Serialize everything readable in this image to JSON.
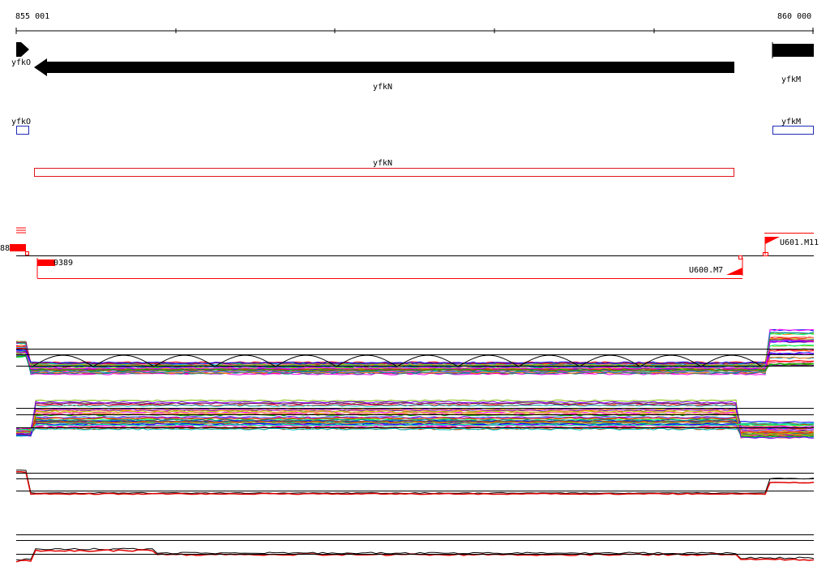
{
  "ruler": {
    "start_label": "855 001",
    "end_label": "860 000"
  },
  "genes": [
    {
      "id": "yfkO",
      "label": "yfkO",
      "strand": "+",
      "color": "#000000"
    },
    {
      "id": "yfkN",
      "label": "yfkN",
      "strand": "-",
      "color": "#000000"
    },
    {
      "id": "yfkM",
      "label": "yfkM",
      "strand": "-",
      "color": "#000000"
    }
  ],
  "annotation_boxes": [
    {
      "id": "yfkO",
      "label": "yfkO",
      "color": "#1f2bb5"
    },
    {
      "id": "yfkM",
      "label": "yfkM",
      "color": "#1f2bb5"
    },
    {
      "id": "yfkN",
      "label": "yfkN",
      "color": "#e0141e"
    }
  ],
  "features": {
    "left_label": "88",
    "mid_label": "0389",
    "u600_label": "U600.M7",
    "u601_label": "U601.M11",
    "color": "#ff0000"
  },
  "track_colors": [
    "#ff0000",
    "#00b000",
    "#0000ff",
    "#ff00ff",
    "#00c8c8",
    "#c8c800",
    "#ff8000",
    "#8000ff",
    "#00ff80",
    "#ff0080",
    "#808000",
    "#008080",
    "#800080",
    "#4080ff",
    "#ff8080",
    "#80c000",
    "#c04000",
    "#0080c0"
  ]
}
